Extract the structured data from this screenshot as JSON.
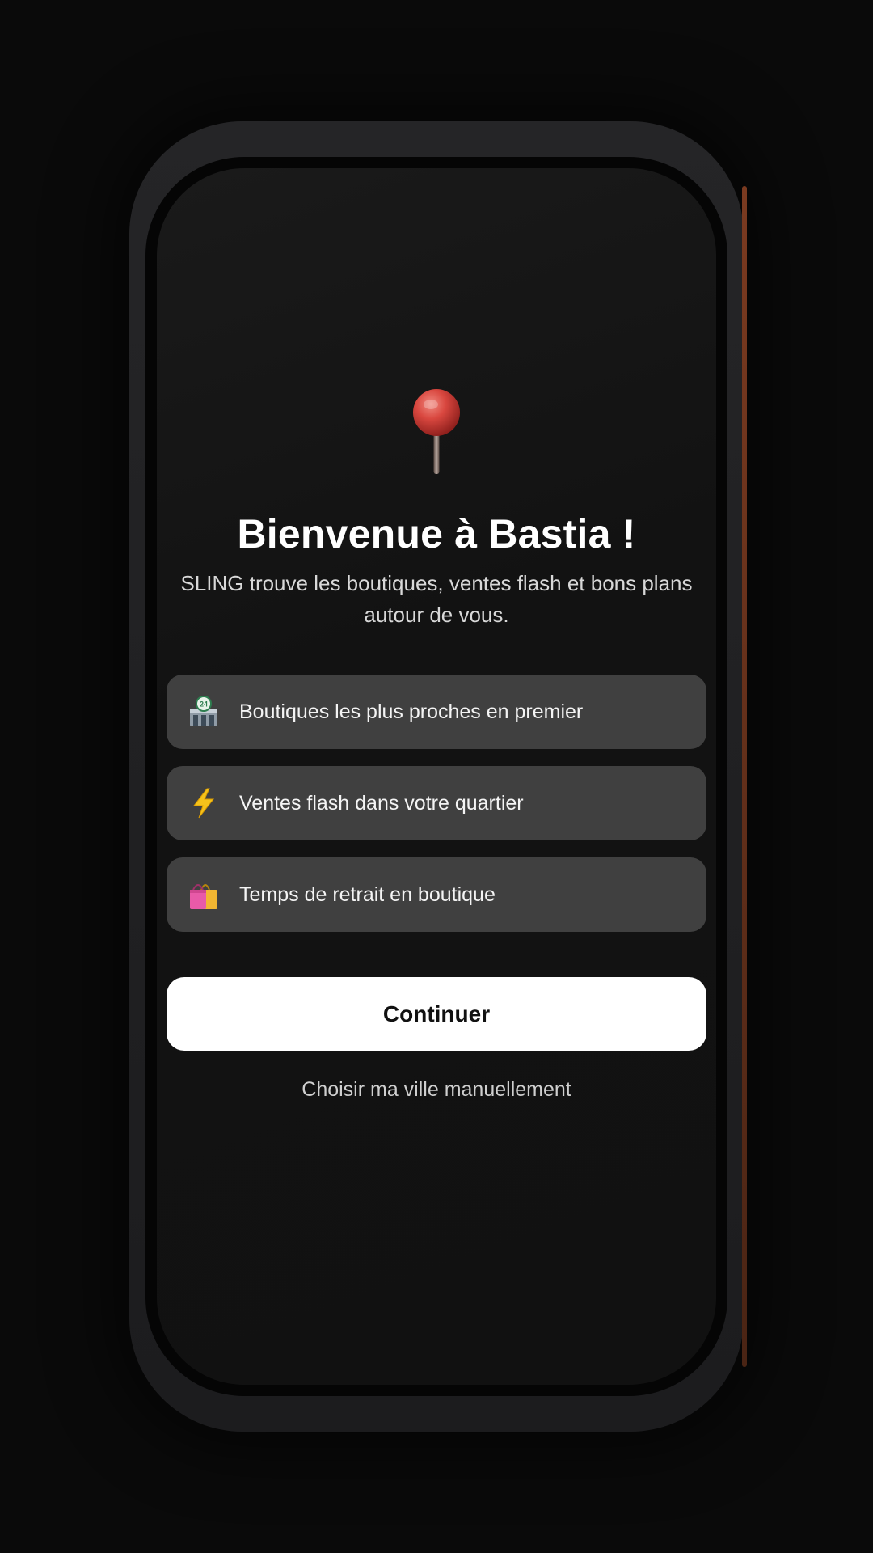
{
  "welcome": {
    "title": "Bienvenue à Bastia !",
    "subtitle": "SLING trouve les boutiques, ventes flash et bons plans autour de vous.",
    "pin_icon": "round-pushpin-icon"
  },
  "features": [
    {
      "icon": "convenience-store-icon",
      "label": "Boutiques les plus proches en premier"
    },
    {
      "icon": "lightning-icon",
      "label": "Ventes flash dans votre quartier"
    },
    {
      "icon": "shopping-bags-icon",
      "label": "Temps de retrait en boutique"
    }
  ],
  "actions": {
    "continue_label": "Continuer",
    "manual_city_label": "Choisir ma ville manuellement"
  },
  "colors": {
    "background": "#0a0a0a",
    "screen": "#121212",
    "feature_card": "#404040",
    "primary_button": "#ffffff",
    "pin_red": "#d9473f"
  }
}
